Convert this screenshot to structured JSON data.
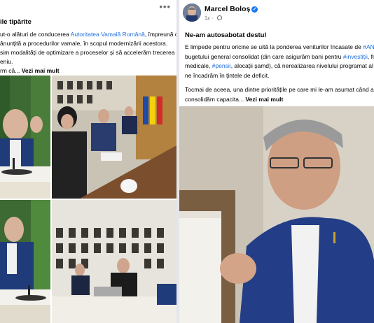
{
  "left_post": {
    "more_icon": "more-horizontal-icon",
    "title": "ile tipărite",
    "lines": [
      {
        "pre": "ut-o alături de conducerea ",
        "link": "Autoritatea Vamală Română",
        "post": ", împreună cu"
      },
      {
        "pre": "ânunțită a procedurilor vamale, în scopul modernizării acestora.",
        "link": "",
        "post": ""
      },
      {
        "pre": "sim modalități de optimizare a proceselor și să accelerăm trecerea la",
        "link": "",
        "post": ""
      },
      {
        "pre": "eniu.",
        "link": "",
        "post": ""
      }
    ],
    "last_line": "rm că...",
    "see_more": "Vezi mai mult"
  },
  "right_post": {
    "author": "Marcel Boloș",
    "verified_icon": "verified-badge-icon",
    "meta_time": "1z",
    "meta_icon": "globe-icon",
    "title": "Ne-am autosabotat destul",
    "paragraph1": [
      {
        "text": "E limpede pentru oricine se uită la ponderea  veniturilor încasate de ",
        "tag": "#ANA",
        "after": ""
      },
      {
        "text": "bugetului general consolidat (din care asigurăm bani pentru ",
        "tag": "#investiții",
        "after": ", fo"
      },
      {
        "text": "medicale, ",
        "tag": "#pensii",
        "after": ", alocații șamd), că nerealizarea nivelului programat al ve"
      },
      {
        "text": "ne încadrăm în țintele de deficit.",
        "tag": "",
        "after": ""
      }
    ],
    "paragraph2": [
      "Tocmai de aceea, una dintre prioritățile pe care mi le-am asumat când am",
      "consolidăm capacita..."
    ],
    "see_more": "Vezi mai mult"
  },
  "colors": {
    "link": "#216fdb",
    "background": "#e4e6eb",
    "card": "#ffffff",
    "verified": "#1877f2"
  }
}
